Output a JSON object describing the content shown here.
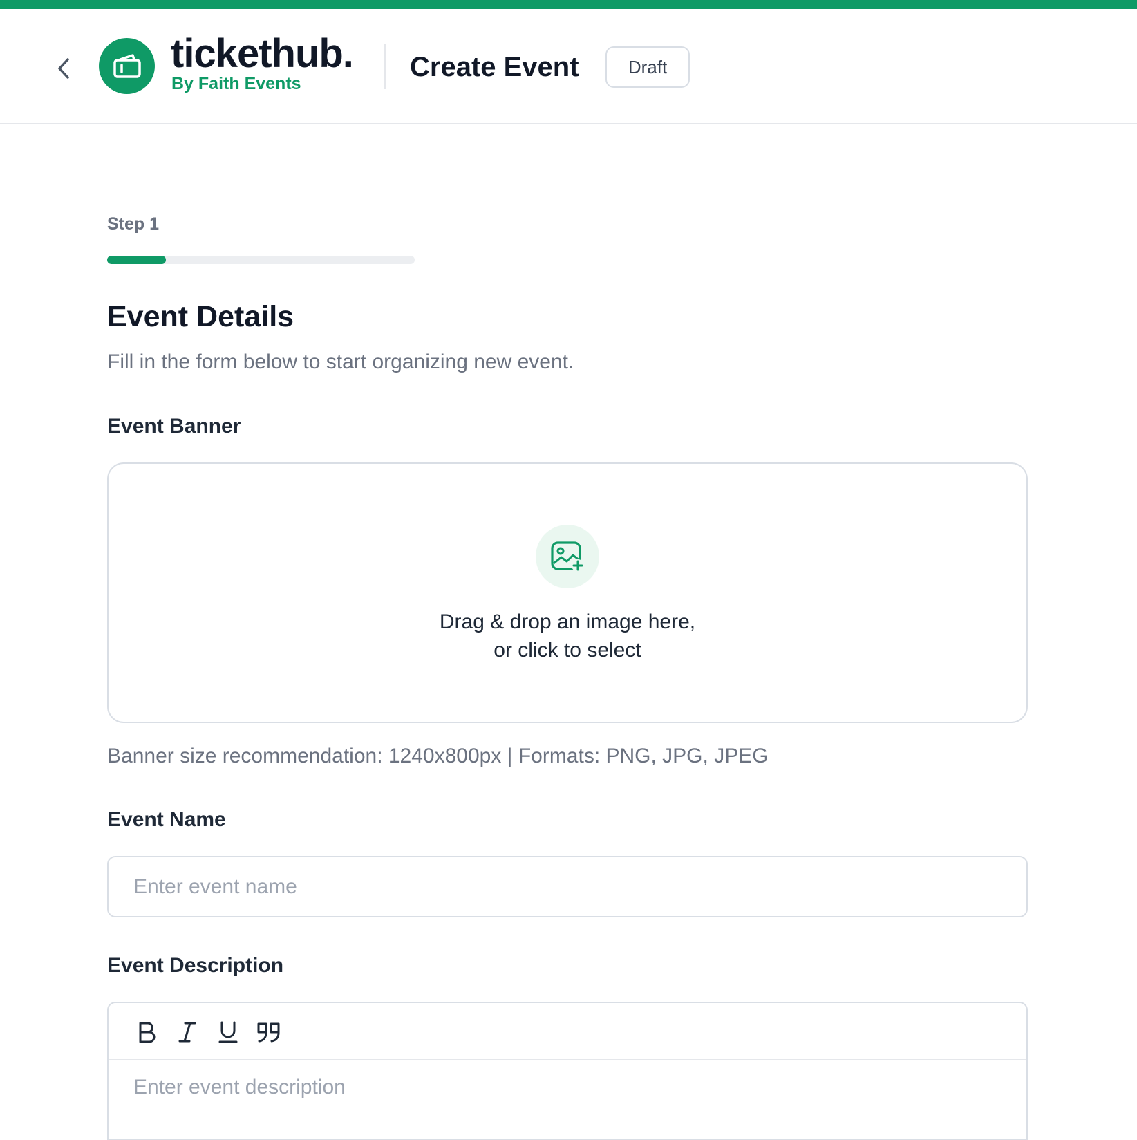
{
  "theme": {
    "accent": "#0f9a66",
    "accent_light": "#eaf7f0",
    "border": "#d9dee5",
    "muted_text": "#6b7280",
    "placeholder_text": "#9ca3af"
  },
  "header": {
    "back_icon": "chevron-left-icon",
    "logo_icon": "ticket-icon",
    "brand_name": "tickethub.",
    "brand_sub": "By Faith Events",
    "page_title": "Create Event",
    "status_badge": "Draft"
  },
  "stepper": {
    "label": "Step 1",
    "progress_fraction": 0.19
  },
  "form": {
    "title": "Event Details",
    "subtitle": "Fill in the form below to start organizing new event.",
    "banner": {
      "label": "Event Banner",
      "icon": "image-add-icon",
      "drop_line1": "Drag & drop an image here,",
      "drop_line2": "or click to select",
      "hint": "Banner size recommendation: 1240x800px | Formats: PNG, JPG, JPEG"
    },
    "name": {
      "label": "Event Name",
      "value": "",
      "placeholder": "Enter event name"
    },
    "description": {
      "label": "Event Description",
      "value": "",
      "placeholder": "Enter event description",
      "toolbar": [
        {
          "name": "bold",
          "icon": "bold-icon"
        },
        {
          "name": "italic",
          "icon": "italic-icon"
        },
        {
          "name": "underline",
          "icon": "underline-icon"
        },
        {
          "name": "quote",
          "icon": "quote-icon"
        }
      ]
    }
  }
}
